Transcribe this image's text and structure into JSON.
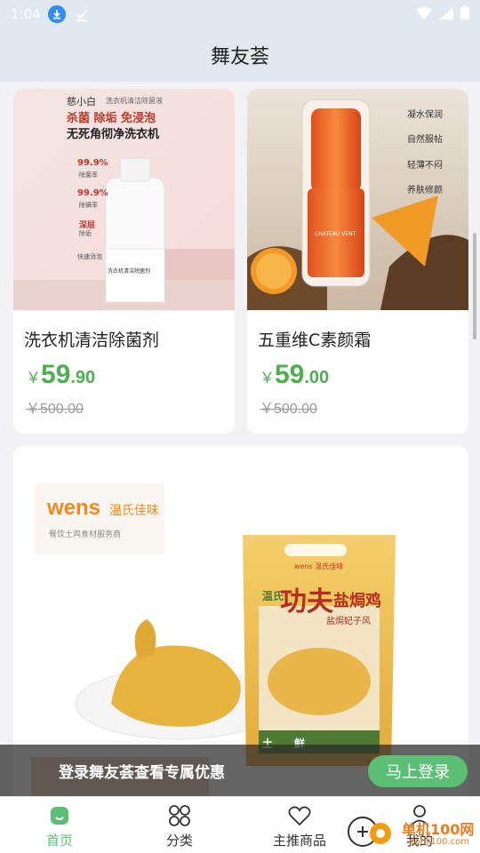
{
  "status": {
    "time": "1:04"
  },
  "header": {
    "title": "舞友荟"
  },
  "products": [
    {
      "name": "洗衣机清洁除菌剂",
      "yen": "￥",
      "price_int": "59",
      "price_dec": ".90",
      "orig_price": "￥500.00"
    },
    {
      "name": "五重维C素颜霜",
      "yen": "￥",
      "price_int": "59",
      "price_dec": ".00",
      "orig_price": "￥500.00"
    }
  ],
  "product_images": {
    "p1": {
      "brand": "慈小白",
      "sub": "洗衣机清洁除菌液",
      "headline1": "杀菌 除垢 免浸泡",
      "headline2": "无死角彻净洗衣机",
      "b1": "99.9%",
      "b1s": "除菌率",
      "b2": "99.9%",
      "b2s": "除螨率",
      "b3": "深层",
      "b3s": "除垢",
      "b4": "快速消泡",
      "bottle_label": "洗衣机清洁除菌剂"
    },
    "p2": {
      "bottle_brand": "CHATEAU VENT",
      "f1": "凝水保润",
      "f2": "自然服帖",
      "f3": "轻薄不闷",
      "f4": "养肤修颜"
    },
    "p3": {
      "brand": "wens",
      "brand_cn": "温氏佳味",
      "tagline": "餐饮土鸡食材服务商",
      "bag_brand": "wens 温氏佳味",
      "bag_title_a": "温氏",
      "bag_title_b": "功夫",
      "bag_title_c": "盐焗鸡",
      "bag_flavor": "盐焗妃子风",
      "bag_bottom1": "土",
      "bag_bottom2": "鲜"
    }
  },
  "banner": {
    "text": "登录舞友荟查看专属优惠",
    "button": "马上登录"
  },
  "tabs": [
    {
      "label": "首页",
      "icon": "home-icon",
      "active": true
    },
    {
      "label": "分类",
      "icon": "category-icon",
      "active": false
    },
    {
      "label": "主推商品",
      "icon": "heart-icon",
      "active": false
    },
    {
      "label": "我的",
      "icon": "user-icon",
      "active": false
    }
  ],
  "watermark": {
    "text": "单机100网",
    "url": "danji100.com"
  },
  "colors": {
    "accent": "#5bbf75",
    "price": "#4caf50",
    "header_bg": "#dfe9ef"
  }
}
